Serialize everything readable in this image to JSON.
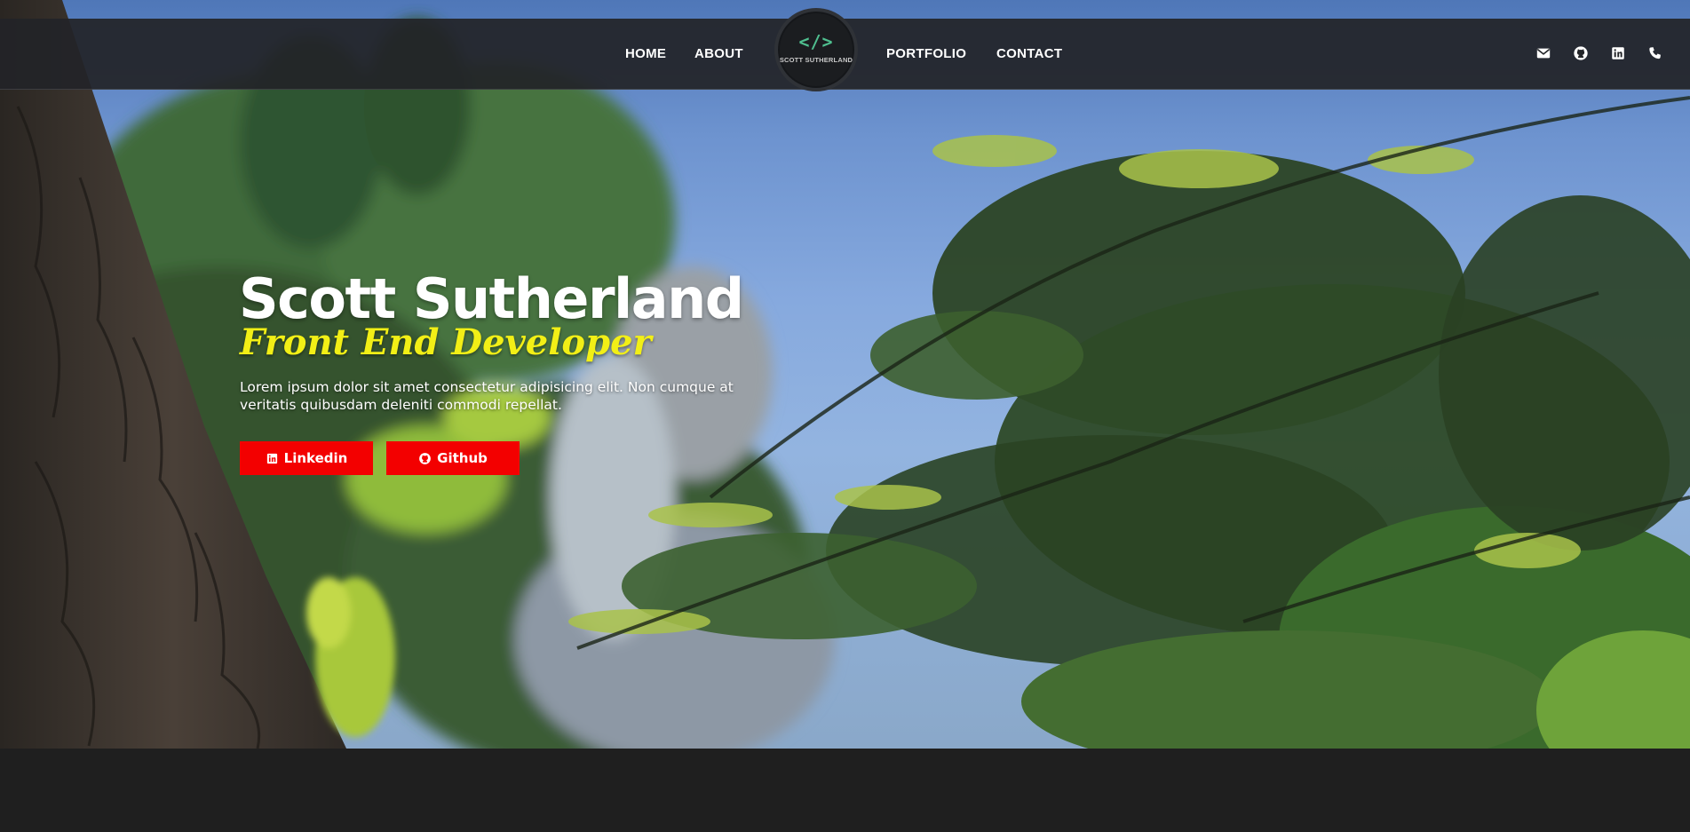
{
  "nav": {
    "left_links": [
      {
        "label": "HOME"
      },
      {
        "label": "ABOUT"
      }
    ],
    "right_links": [
      {
        "label": "PORTFOLIO"
      },
      {
        "label": "CONTACT"
      }
    ],
    "logo": {
      "code": "</>",
      "name": "SCOTT SUTHERLAND"
    },
    "social_icons": [
      "envelope-icon",
      "github-icon",
      "linkedin-icon",
      "phone-icon"
    ]
  },
  "hero": {
    "name": "Scott Sutherland",
    "role": "Front End Developer",
    "description": "Lorem ipsum dolor sit amet consectetur adipisicing elit. Non cumque at veritatis quibusdam deleniti commodi repellat.",
    "buttons": [
      {
        "label": "Linkedin",
        "icon": "linkedin-icon"
      },
      {
        "label": "Github",
        "icon": "github-icon"
      }
    ]
  },
  "colors": {
    "accent_red": "#f30000",
    "role_yellow": "#f2ef16",
    "logo_green": "#4fbf8f",
    "nav_bg": "#222428",
    "page_bg": "#1f1f1f"
  }
}
